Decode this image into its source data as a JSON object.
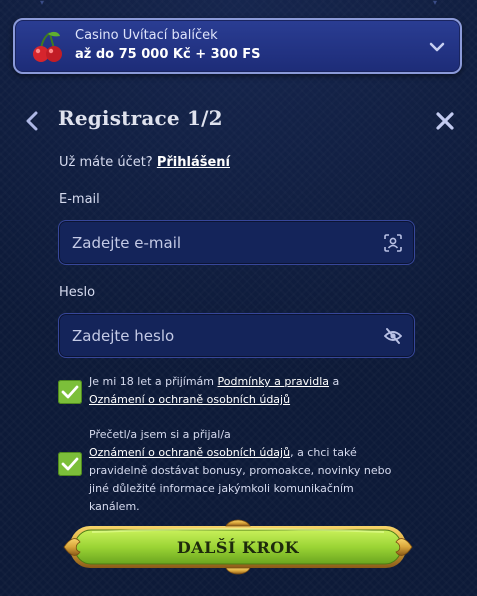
{
  "bonus": {
    "title": "Casino Uvítací balíček",
    "subtitle": "až do 75 000 Kč + 300 FS",
    "icon": "cherry-icon",
    "expand_icon": "chevron-down-icon"
  },
  "header": {
    "title": "Registrace 1/2",
    "back_icon": "chevron-left-icon",
    "close_icon": "close-icon"
  },
  "login": {
    "prompt": "Už máte účet?",
    "link": "Přihlášení"
  },
  "form": {
    "email": {
      "label": "E-mail",
      "placeholder": "Zadejte e-mail",
      "value": "",
      "icon": "user-scan-icon"
    },
    "password": {
      "label": "Heslo",
      "placeholder": "Zadejte heslo",
      "value": "",
      "icon": "eye-off-icon"
    }
  },
  "consents": [
    {
      "checked": true,
      "text_before": "Je mi 18 let a přijímám",
      "link1": "Podmínky a pravidla",
      "text_mid": "a",
      "link2": "Oznámení o ochraně osobních údajů"
    },
    {
      "checked": true,
      "text_before": "Přečetl/a jsem si a přijal/a",
      "link": "Oznámení o ochraně osobních údajů",
      "text_after": ", a chci také pravidelně dostávat bonusy, promoakce, novinky nebo jiné důležité informace jakýmkoli komunikačním kanálem."
    }
  ],
  "next_button": {
    "label": "DALŠÍ KROK"
  },
  "colors": {
    "background": "#0d1a38",
    "banner": "#2a3d93",
    "input": "#14245a",
    "checkbox": "#7cbf3a",
    "button": "#9bd435",
    "button_frame": "#d9a53a"
  }
}
